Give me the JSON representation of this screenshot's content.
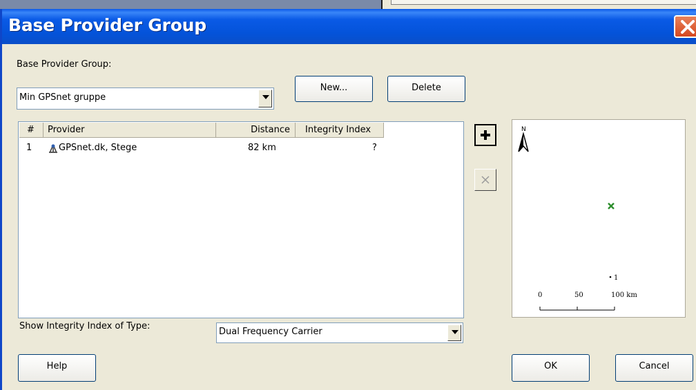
{
  "dialog": {
    "title": "Base Provider Group",
    "group_label": "Base Provider Group:",
    "group_value": "Min GPSnet gruppe",
    "new_label": "New...",
    "delete_label": "Delete",
    "show_label": "Show Integrity Index of Type:",
    "show_value": "Dual Frequency Carrier",
    "help_label": "Help",
    "ok_label": "OK",
    "cancel_label": "Cancel"
  },
  "table": {
    "headers": [
      "#",
      "Provider",
      "Distance",
      "Integrity Index"
    ],
    "rows": [
      {
        "num": "1",
        "provider": "GPSnet.dk, Stege",
        "distance": "82 km",
        "integrity": "?"
      }
    ]
  },
  "map": {
    "north": "N",
    "point_label": "1",
    "scale_ticks": [
      "0",
      "50",
      "100 km"
    ]
  },
  "colors": {
    "titlebar": "#0453d9",
    "close": "#d5481f",
    "marker": "#2f8f2f"
  }
}
